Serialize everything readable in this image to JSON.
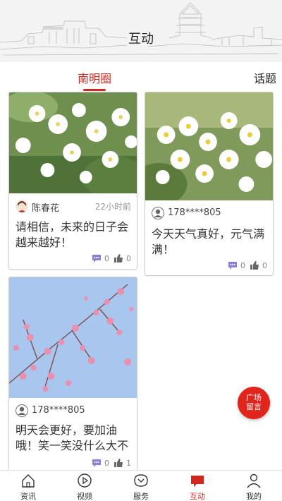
{
  "header": {
    "title": "互动"
  },
  "tabs": [
    {
      "label": "南明圈",
      "active": true
    },
    {
      "label": "话题",
      "active": false
    }
  ],
  "posts": [
    {
      "user": "陈春花",
      "time": "22小时前",
      "text": "请相信，未来的日子会越来越好！",
      "comments": "0",
      "likes": "0",
      "image": "white-jasmine-flowers"
    },
    {
      "user": "178****805",
      "time": "",
      "text": "今天天气真好，元气满满！",
      "comments": "0",
      "likes": "0",
      "image": "white-blossom-flowers"
    },
    {
      "user": "178****805",
      "time": "",
      "text": "明天会更好，要加油哦！笑一笑没什么大不",
      "comments": "0",
      "likes": "1",
      "image": "pink-plum-blossoms"
    }
  ],
  "fab": {
    "label": "广场留言"
  },
  "nav": [
    {
      "label": "资讯",
      "icon": "home-icon",
      "active": false
    },
    {
      "label": "视频",
      "icon": "play-icon",
      "active": false
    },
    {
      "label": "服务",
      "icon": "service-icon",
      "active": false
    },
    {
      "label": "互动",
      "icon": "chat-icon",
      "active": true
    },
    {
      "label": "我的",
      "icon": "person-icon",
      "active": false
    }
  ],
  "colors": {
    "accent": "#d0281f",
    "fab": "#e2251c",
    "comment_icon": "#8e7fd6"
  }
}
